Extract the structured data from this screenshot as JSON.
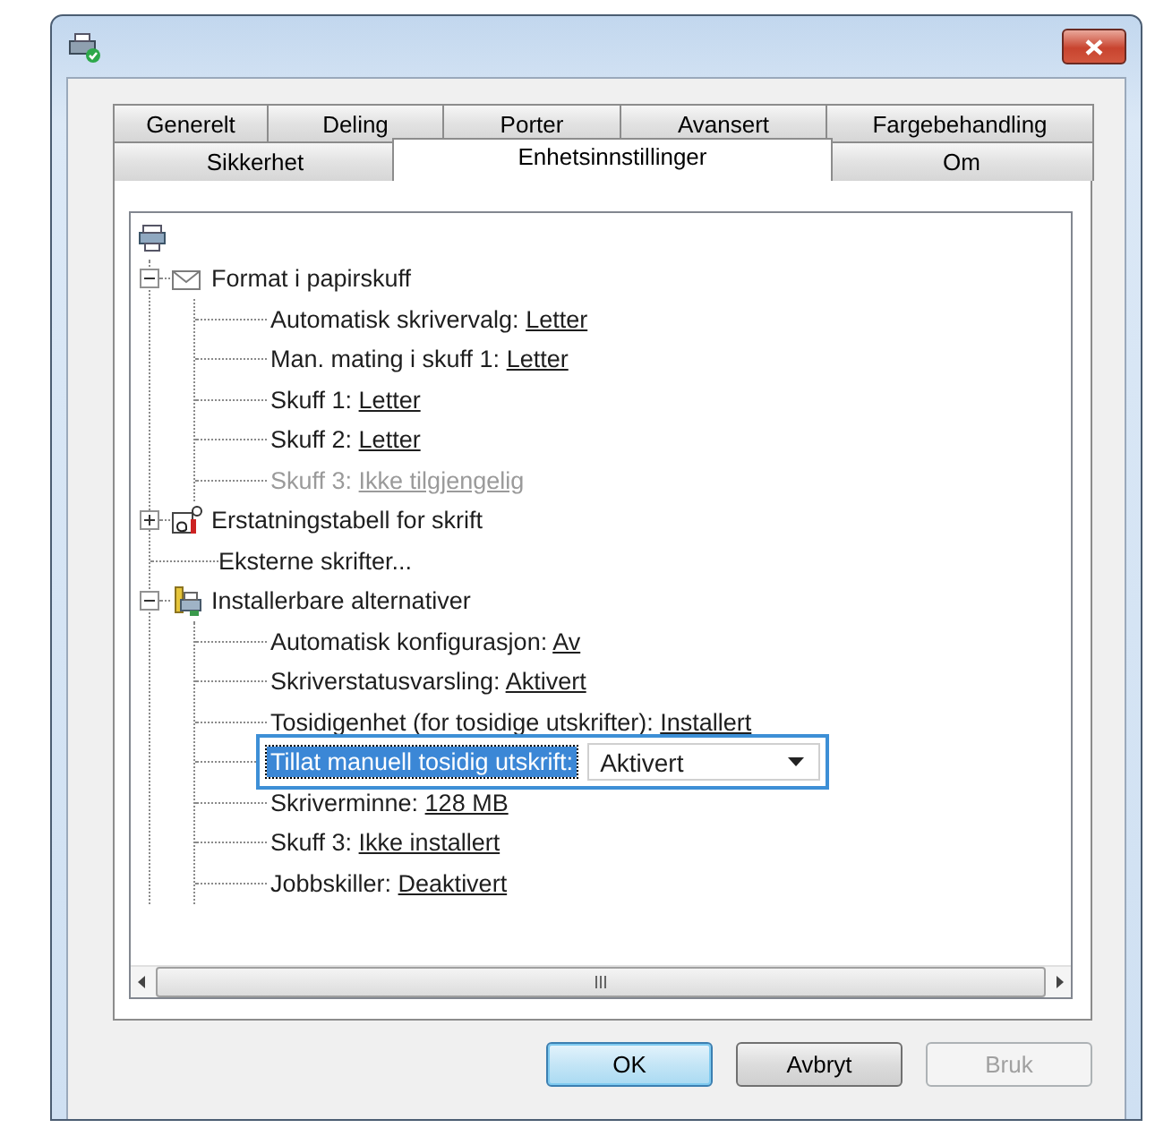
{
  "tab_rows": [
    [
      {
        "label": "Generelt",
        "selected": false
      },
      {
        "label": "Deling",
        "selected": false
      },
      {
        "label": "Porter",
        "selected": false
      },
      {
        "label": "Avansert",
        "selected": false
      },
      {
        "label": "Fargebehandling",
        "selected": false
      }
    ],
    [
      {
        "label": "Sikkerhet",
        "selected": false
      },
      {
        "label": "Enhetsinnstillinger",
        "selected": true
      },
      {
        "label": "Om",
        "selected": false
      }
    ]
  ],
  "tree": {
    "kind": "root",
    "children": [
      {
        "kind": "group",
        "label": "Format i papirskuff",
        "expanded": true,
        "children": [
          {
            "kind": "setting",
            "label": "Automatisk skrivervalg:",
            "value": "Letter",
            "selected": false
          },
          {
            "kind": "setting",
            "label": "Man. mating i skuff 1:",
            "value": "Letter",
            "selected": false
          },
          {
            "kind": "setting",
            "label": "Skuff 1:",
            "value": "Letter",
            "selected": false
          },
          {
            "kind": "setting",
            "label": "Skuff 2:",
            "value": "Letter",
            "selected": false
          },
          {
            "kind": "setting",
            "label": "Skuff 3:",
            "value": "Ikke tilgjengelig",
            "disabled": true,
            "selected": false
          }
        ]
      },
      {
        "kind": "group",
        "label": "Erstatningstabell for skrift",
        "expanded": false
      },
      {
        "kind": "leaf",
        "label": "Eksterne skrifter..."
      },
      {
        "kind": "group",
        "label": "Installerbare alternativer",
        "expanded": true,
        "children": [
          {
            "kind": "setting",
            "label": "Automatisk konfigurasjon:",
            "value": "Av",
            "selected": false
          },
          {
            "kind": "setting",
            "label": "Skriverstatusvarsling:",
            "value": "Aktivert",
            "selected": false
          },
          {
            "kind": "setting",
            "label": "Tosidigenhet (for tosidige utskrifter):",
            "value": "Installert",
            "selected": false
          },
          {
            "kind": "dropdown",
            "label": "Tillat manuell tosidig utskrift:",
            "value": "Aktivert",
            "selected": true
          },
          {
            "kind": "setting",
            "label": "Skriverminne:",
            "value": "128 MB",
            "selected": false
          },
          {
            "kind": "setting",
            "label": "Skuff 3:",
            "value": "Ikke installert",
            "selected": false
          },
          {
            "kind": "setting",
            "label": "Jobbskiller:",
            "value": "Deaktivert",
            "selected": false
          }
        ]
      }
    ]
  },
  "buttons": [
    {
      "label": "OK",
      "default": true,
      "disabled": false
    },
    {
      "label": "Avbryt",
      "default": false,
      "disabled": false
    },
    {
      "label": "Bruk",
      "default": false,
      "disabled": true
    }
  ]
}
